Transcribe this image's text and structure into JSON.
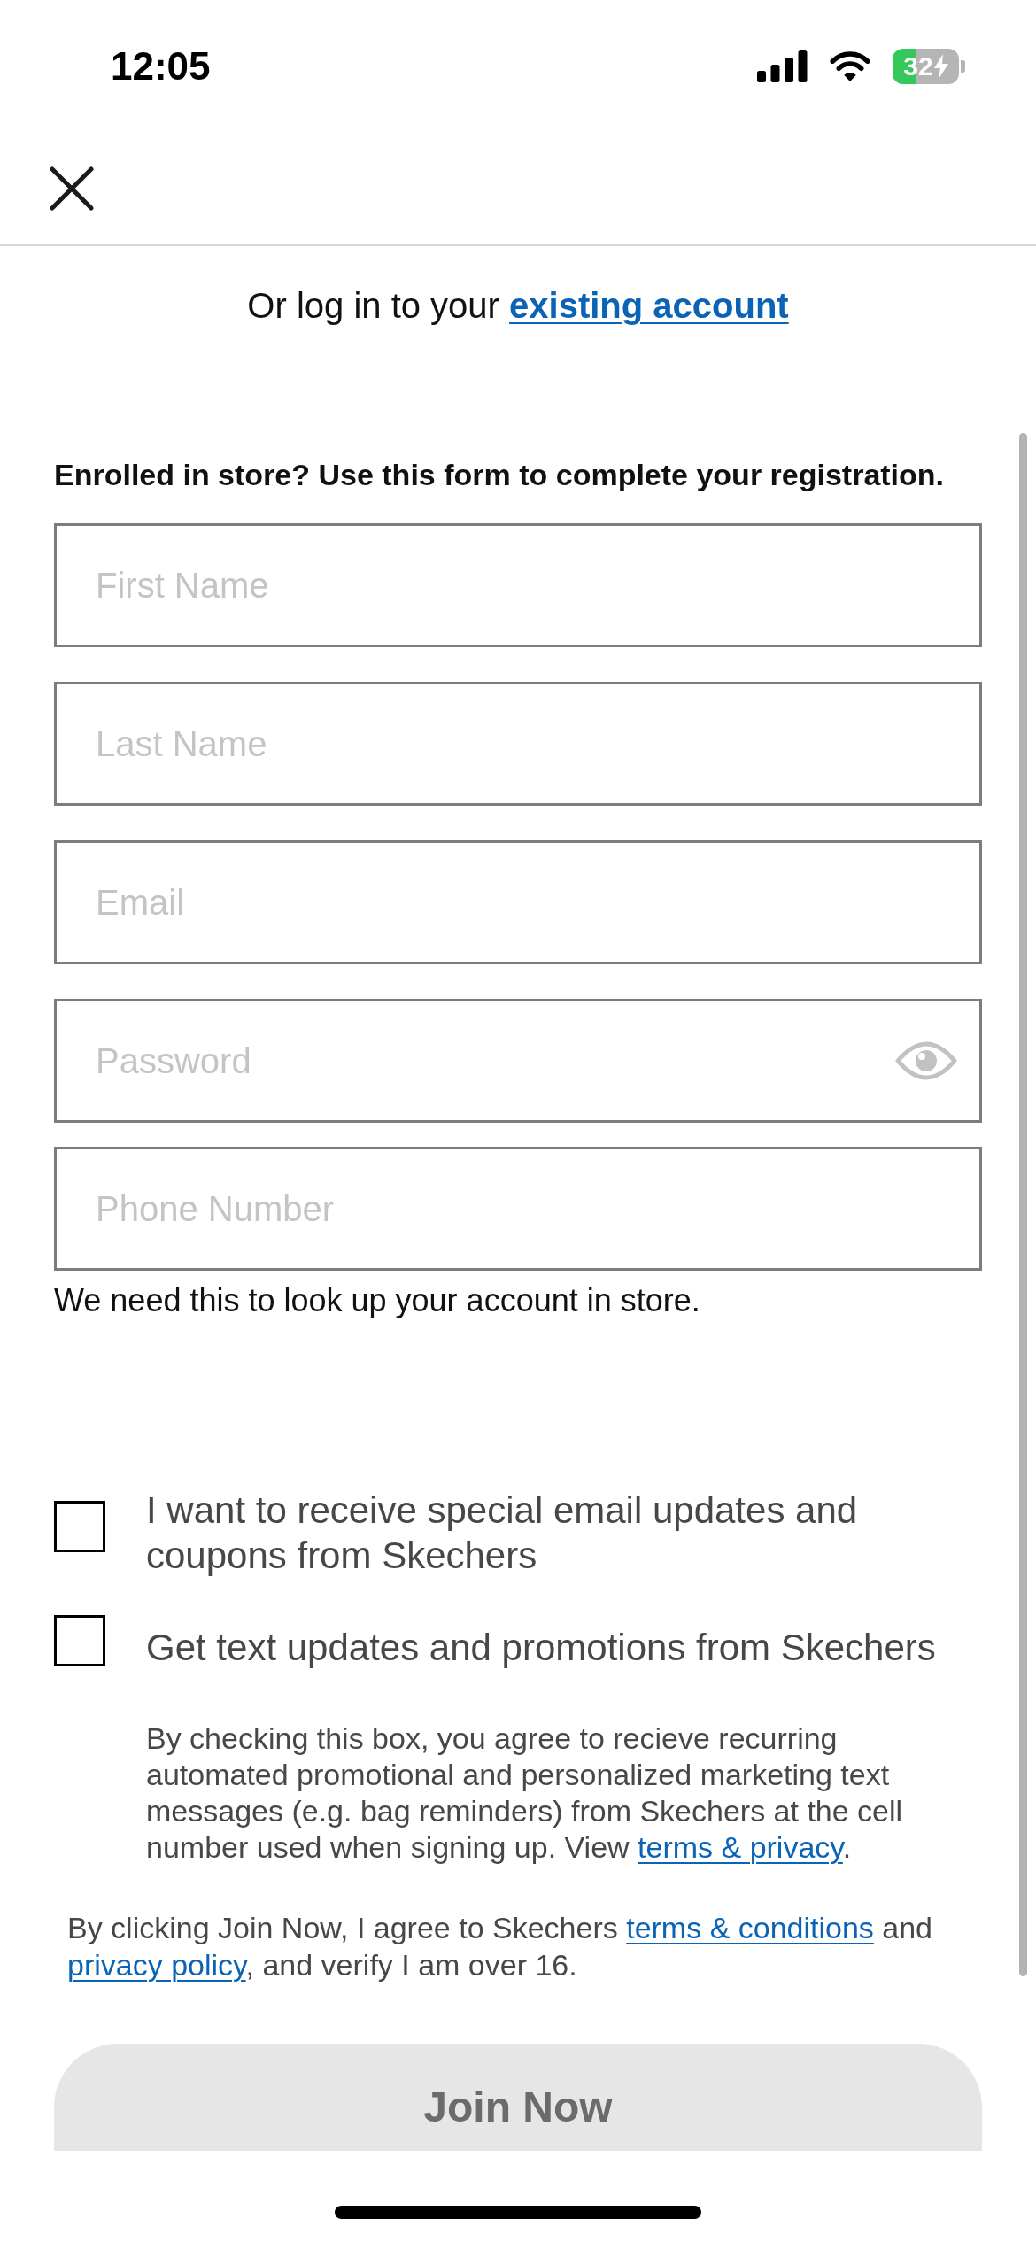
{
  "status_bar": {
    "time": "12:05",
    "battery": "32"
  },
  "heading": {
    "login_prompt": [
      {
        "kind": "text",
        "text": "Or log in to your "
      },
      {
        "kind": "link",
        "text": "existing account"
      }
    ]
  },
  "form": {
    "intro": "Enrolled in store? Use this form to complete your registration.",
    "fields": [
      {
        "kind": "text",
        "placeholder": "First Name"
      },
      {
        "kind": "text",
        "placeholder": "Last Name"
      },
      {
        "kind": "text",
        "placeholder": "Email"
      },
      {
        "kind": "password",
        "placeholder": "Password"
      },
      {
        "kind": "text",
        "placeholder": "Phone Number"
      }
    ],
    "phone_hint": "We need this to look up your account in store."
  },
  "opt_ins": [
    {
      "label": "I want to receive special email updates and coupons from Skechers",
      "checked": false
    },
    {
      "label": "Get text updates and promotions from Skechers",
      "checked": false
    }
  ],
  "sms_disclaimer": [
    {
      "kind": "text",
      "text": "By checking this box, you agree to recieve recurring automated promotional and personalized marketing text messages (e.g. bag reminders) from Skechers at the cell number used when signing up. View "
    },
    {
      "kind": "link",
      "text": "terms & privacy"
    },
    {
      "kind": "text",
      "text": "."
    }
  ],
  "legal": [
    {
      "kind": "text",
      "text": "By clicking Join Now, I agree to Skechers "
    },
    {
      "kind": "link",
      "text": "terms & conditions"
    },
    {
      "kind": "text",
      "text": " and "
    },
    {
      "kind": "link",
      "text": "privacy policy"
    },
    {
      "kind": "text",
      "text": ", and verify I am over 16."
    }
  ],
  "join_button": {
    "label": "Join Now",
    "disabled": true
  }
}
